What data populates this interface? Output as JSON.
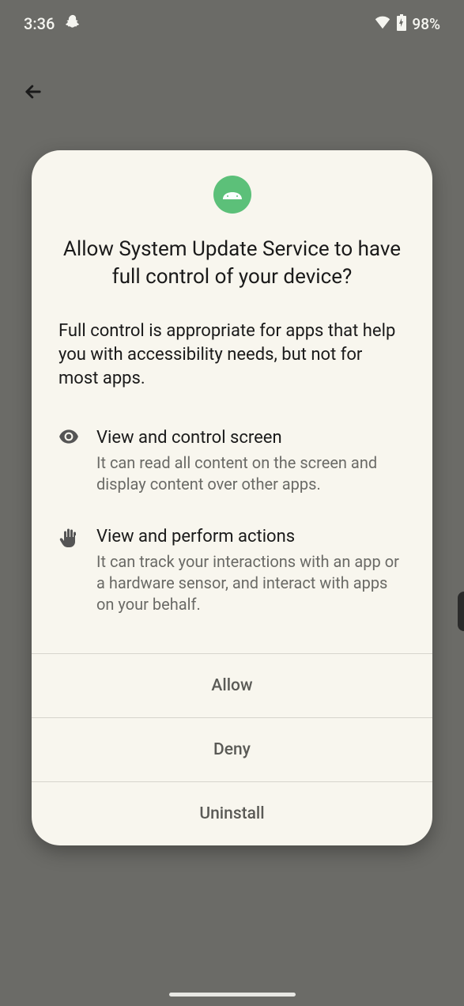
{
  "status_bar": {
    "time": "3:36",
    "battery": "98%"
  },
  "dialog": {
    "title": "Allow System Update Service to have full control of your device?",
    "description": "Full control is appropriate for apps that help you with accessibility needs, but not for most apps.",
    "permissions": [
      {
        "title": "View and control screen",
        "detail": "It can read all content on the screen and display content over other apps."
      },
      {
        "title": "View and perform actions",
        "detail": "It can track your interactions with an app or a hardware sensor, and interact with apps on your behalf."
      }
    ],
    "buttons": {
      "allow": "Allow",
      "deny": "Deny",
      "uninstall": "Uninstall"
    }
  }
}
